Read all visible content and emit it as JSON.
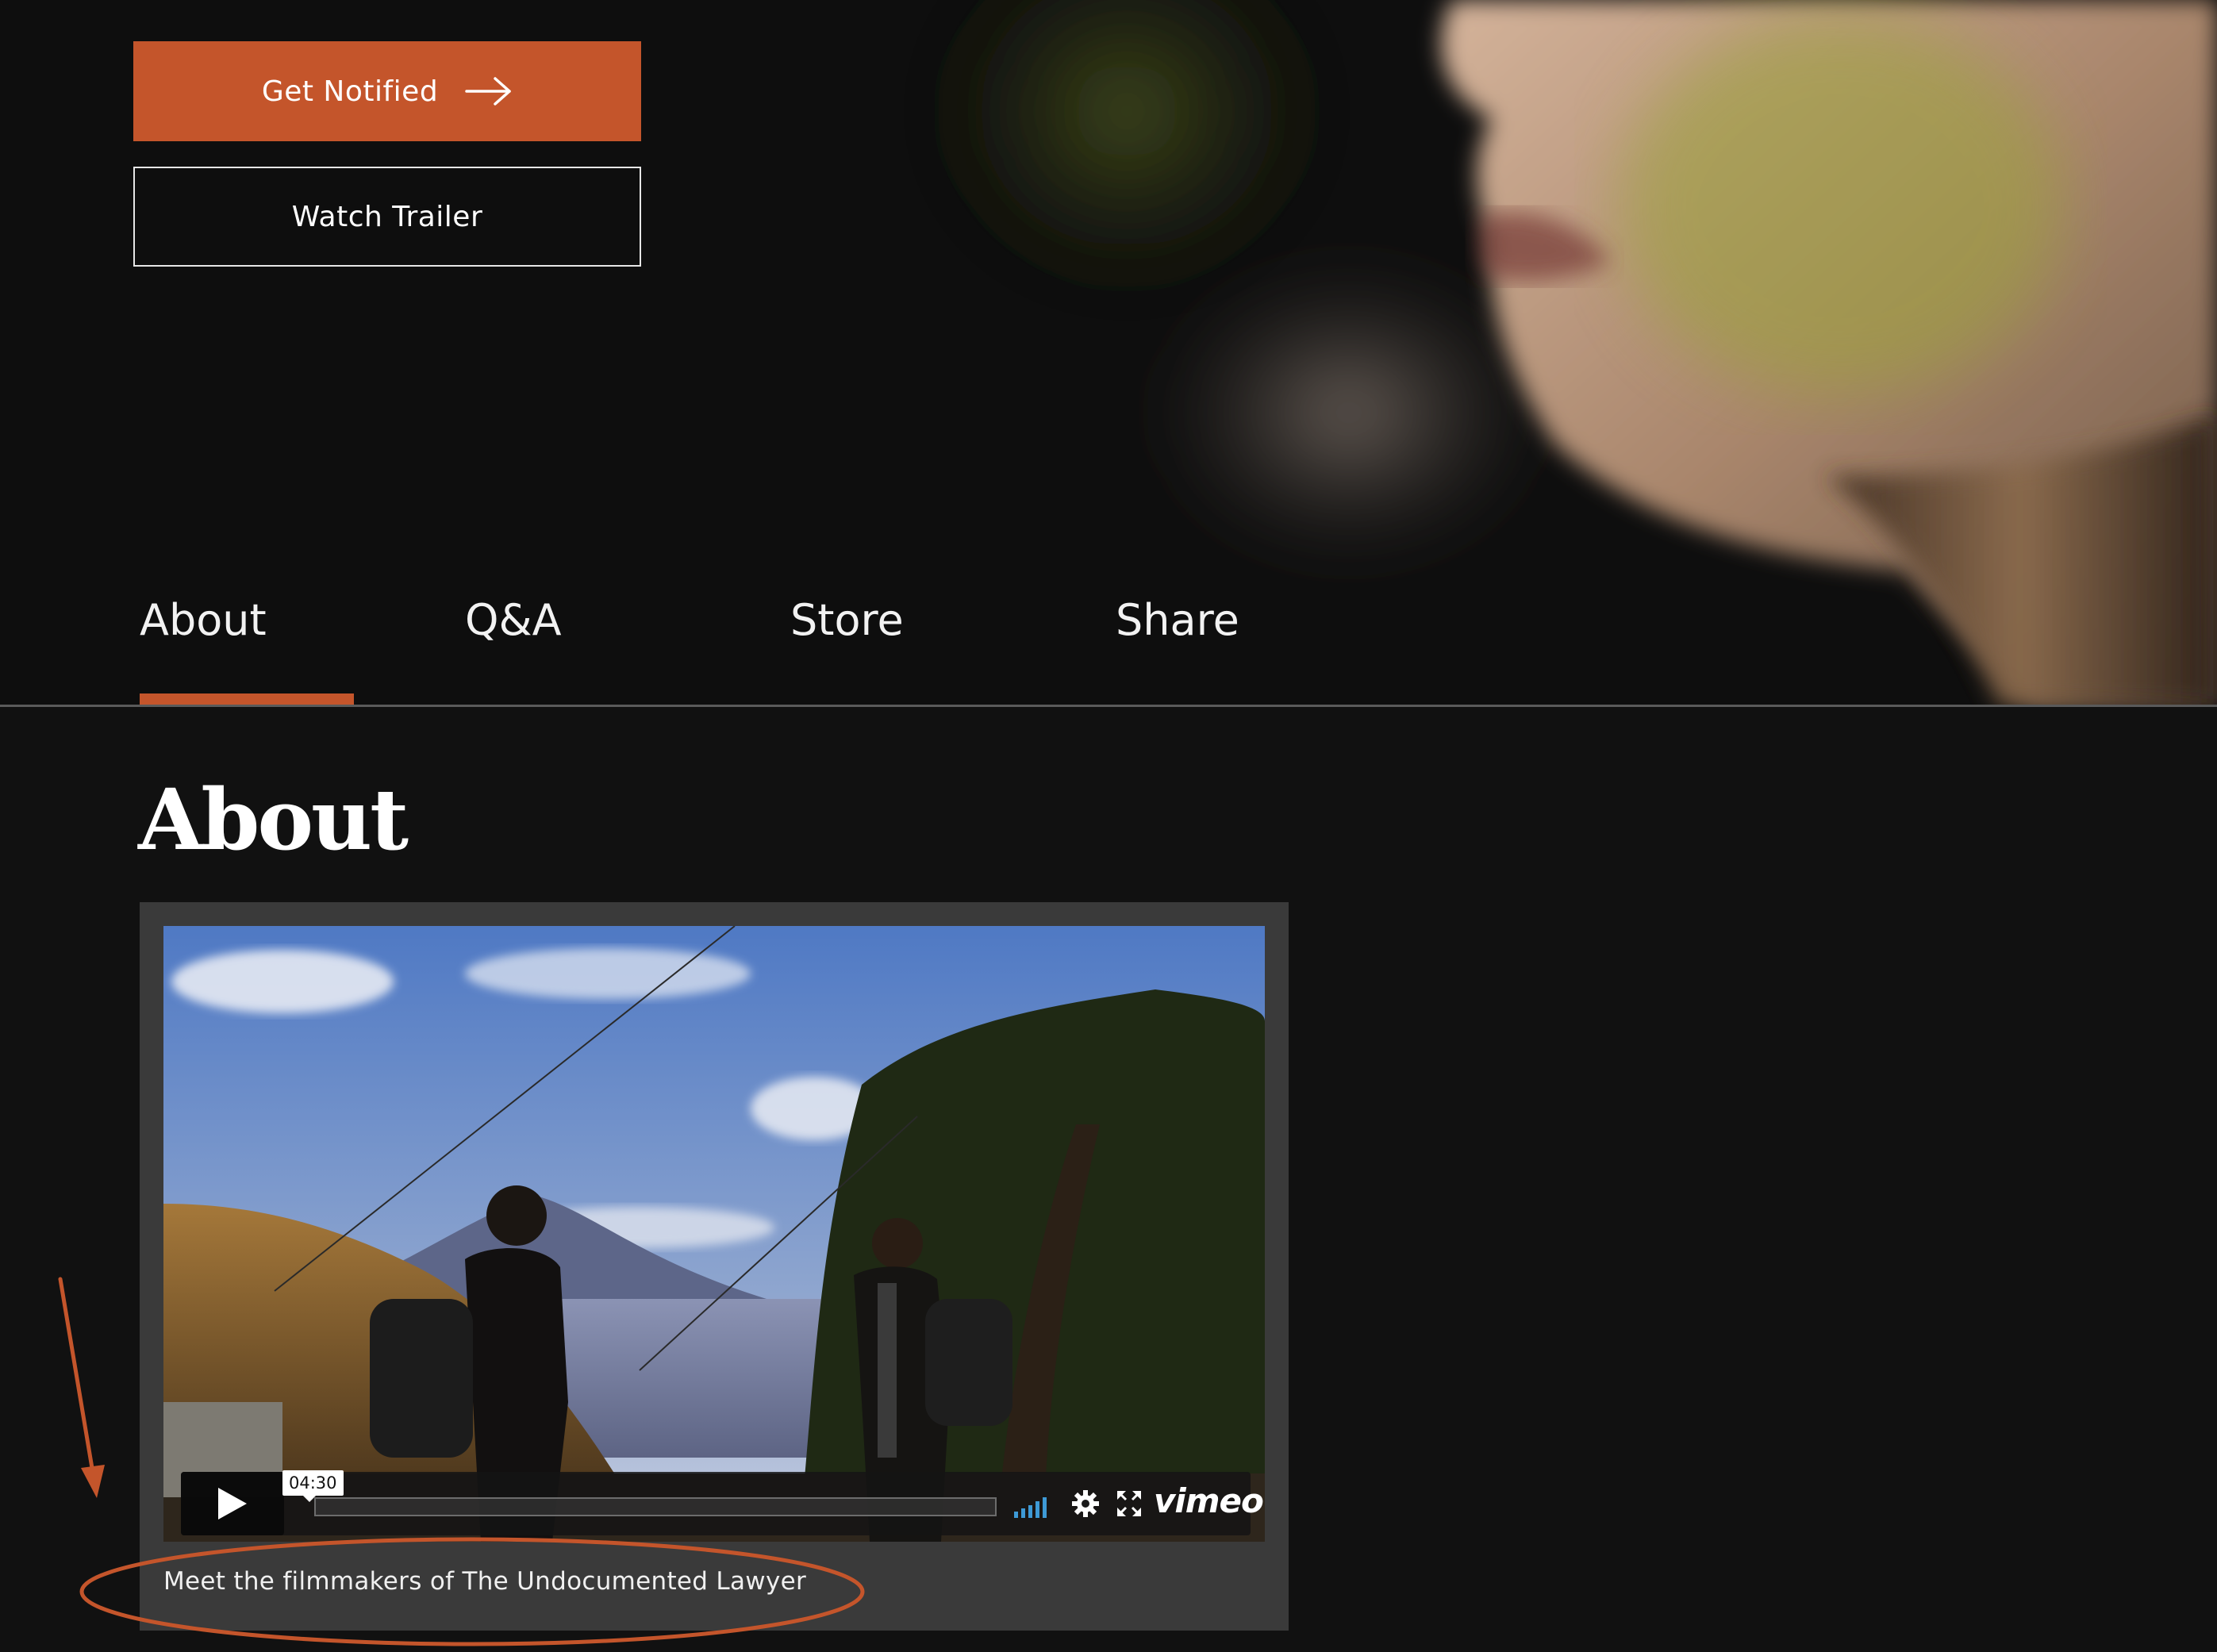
{
  "hero": {
    "notify_label": "Get Notified",
    "trailer_label": "Watch Trailer",
    "accent_color": "#c4552b"
  },
  "tabs": [
    {
      "label": "About",
      "active": true
    },
    {
      "label": "Q&A",
      "active": false
    },
    {
      "label": "Store",
      "active": false
    },
    {
      "label": "Share",
      "active": false
    }
  ],
  "about": {
    "title": "About",
    "video": {
      "duration": "04:30",
      "player_brand": "vimeo",
      "icons": [
        "play-icon",
        "volume-icon",
        "gear-icon",
        "fullscreen-icon"
      ]
    },
    "caption": "Meet the filmmakers of The Undocumented Lawyer"
  },
  "annotation_color": "#c4552b"
}
